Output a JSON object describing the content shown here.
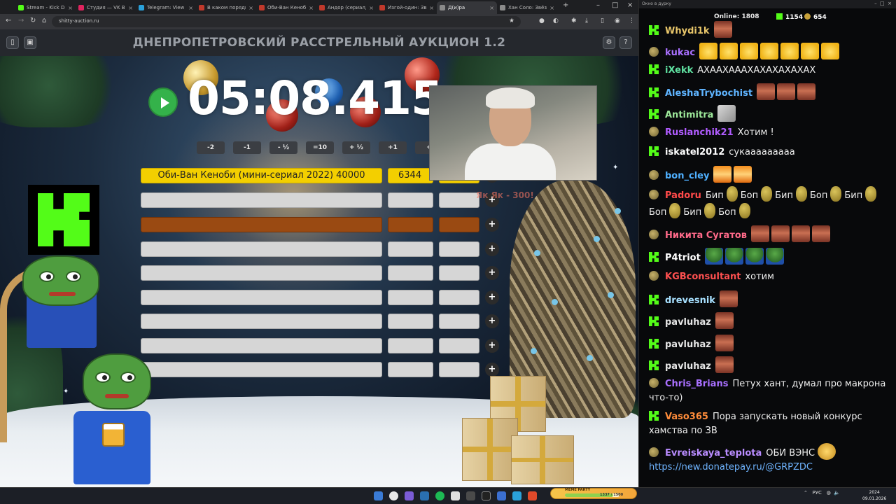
{
  "browser": {
    "tabs": [
      {
        "label": "Stream - Kick Dash",
        "color": "#53fc18"
      },
      {
        "label": "Студия — VK Видео",
        "color": "#e0245e"
      },
      {
        "label": "Telegram: View @",
        "color": "#2aa1da"
      },
      {
        "label": "В каком порядке",
        "color": "#c0392b"
      },
      {
        "label": "Оби-Ван Кеноби",
        "color": "#c0392b"
      },
      {
        "label": "Андор (сериал, 1",
        "color": "#c0392b"
      },
      {
        "label": "Изгой-один: Звёзд",
        "color": "#c0392b"
      },
      {
        "label": "Д(и)ра",
        "color": "#8a8a8a"
      },
      {
        "label": "Хан Соло: Звёздн",
        "color": "#8a8a8a"
      }
    ],
    "url": "shitty-auction.ru"
  },
  "auction": {
    "title": "ДНЕПРОПЕТРОВСКИЙ РАССТРЕЛЬНЫЙ АУКЦИОН 1.2",
    "timer": "05:08.415",
    "time_buttons": [
      "-2",
      "-1",
      "- ½",
      "=10",
      "+ ½",
      "+1",
      "+"
    ],
    "lots": [
      {
        "name": "Оби-Ван Кеноби (мини-сериал 2022) 40000",
        "amount": "6344",
        "highlight": "gold"
      },
      {
        "name": "",
        "amount": "",
        "highlight": "none"
      },
      {
        "name": "",
        "amount": "",
        "highlight": "brown"
      },
      {
        "name": "",
        "amount": "",
        "highlight": "none"
      },
      {
        "name": "",
        "amount": "",
        "highlight": "none"
      },
      {
        "name": "",
        "amount": "",
        "highlight": "none"
      },
      {
        "name": "",
        "amount": "",
        "highlight": "none"
      },
      {
        "name": "",
        "amount": "",
        "highlight": "none"
      },
      {
        "name": "",
        "amount": "",
        "highlight": "none"
      }
    ],
    "faint_text": "Як Як - 300!",
    "plus_label": "+"
  },
  "chat": {
    "window_title": "Окно в дурку",
    "online_label": "Online:",
    "online_count": "1808",
    "kick_count": "1154",
    "other_count": "654",
    "messages": [
      {
        "platform": "kick",
        "user": "Whydi1k",
        "color": "#e8c66a",
        "text": "",
        "emotes": [
          "face"
        ]
      },
      {
        "platform": "tw",
        "user": "kukac",
        "color": "#a970ff",
        "text": "",
        "emotes": [
          "laugh",
          "laugh",
          "laugh",
          "laugh",
          "laugh",
          "laugh",
          "laugh"
        ]
      },
      {
        "platform": "kick",
        "user": "iXekk",
        "color": "#5fe0a0",
        "text": "АХААХАААХАХАХАХАХАХ",
        "emotes": []
      },
      {
        "platform": "kick",
        "user": "AleshaTrybochist",
        "color": "#5fb4ff",
        "text": "",
        "emotes": [
          "face",
          "face",
          "face"
        ]
      },
      {
        "platform": "kick",
        "user": "Antimitra",
        "color": "#9de89a",
        "text": "",
        "emotes": [
          "meme"
        ]
      },
      {
        "platform": "tw",
        "user": "Ruslanchik21",
        "color": "#b05cff",
        "text": "Хотим !",
        "emotes": []
      },
      {
        "platform": "kick",
        "user": "iskatel2012",
        "color": "#ffffff",
        "text": "сукааааааааа",
        "emotes": []
      },
      {
        "platform": "tw",
        "user": "bon_cley",
        "color": "#4fb0ff",
        "text": "",
        "emotes": [
          "tiger",
          "tiger"
        ]
      },
      {
        "platform": "tw",
        "user": "Padoru",
        "color": "#ff4a4a",
        "text_parts": [
          "Бип",
          "Боп",
          "Бип",
          "Боп",
          "Бип",
          "Боп",
          "Бип",
          "Боп"
        ]
      },
      {
        "platform": "tw",
        "user": "Никита Сугатов",
        "color": "#ff6a8a",
        "text": "",
        "emotes": [
          "face",
          "face",
          "face",
          "face"
        ]
      },
      {
        "platform": "kick",
        "user": "P4triot",
        "color": "#ffffff",
        "text": "",
        "emotes": [
          "pepe",
          "pepe",
          "pepe",
          "pepe"
        ]
      },
      {
        "platform": "tw",
        "user": "KGBconsultant",
        "color": "#ff5050",
        "text": "хотим",
        "emotes": []
      },
      {
        "platform": "kick",
        "user": "drevesnik",
        "color": "#a7e0ff",
        "text": "",
        "emotes": [
          "face"
        ]
      },
      {
        "platform": "kick",
        "user": "pavluhaz",
        "color": "#e6e6e6",
        "text": "",
        "emotes": [
          "face"
        ]
      },
      {
        "platform": "kick",
        "user": "pavluhaz",
        "color": "#e6e6e6",
        "text": "",
        "emotes": [
          "face"
        ]
      },
      {
        "platform": "kick",
        "user": "pavluhaz",
        "color": "#e6e6e6",
        "text": "",
        "emotes": [
          "face"
        ]
      },
      {
        "platform": "tw",
        "user": "Chris_Brians",
        "color": "#a970ff",
        "text": "Петух хант, думал про макрона",
        "text2": "что-то)"
      },
      {
        "platform": "kick",
        "user": "Vaso365",
        "color": "#ff8c3a",
        "text": "Пора запускать новый конкурс",
        "text2": "хамства по ЗВ"
      },
      {
        "platform": "tw",
        "user": "Evreiskaya_teplota",
        "color": "#b98cff",
        "text": "ОБИ ВЭНС",
        "link": "https://new.donatepay.ru/@GRPZDC"
      }
    ]
  },
  "taskbar": {
    "lang": "РУС",
    "time": "2024",
    "date": "09.01.2026",
    "meme_party_label": "MEME PARTY",
    "meme_party_progress_text": "1337 / 1500",
    "meme_party_progress": 0.89
  }
}
